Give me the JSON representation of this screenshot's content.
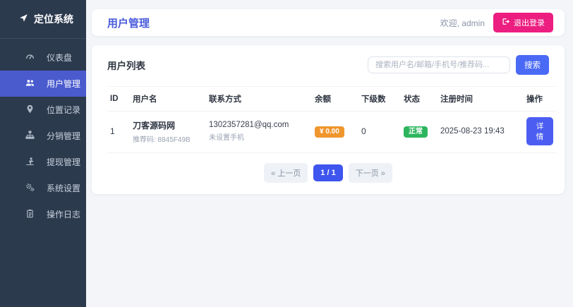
{
  "app": {
    "name": "定位系统",
    "logo_icon": "location-arrow-icon"
  },
  "sidebar": {
    "items": [
      {
        "label": "仪表盘",
        "icon": "gauge-icon",
        "active": false
      },
      {
        "label": "用户管理",
        "icon": "users-icon",
        "active": true
      },
      {
        "label": "位置记录",
        "icon": "map-marker-icon",
        "active": false
      },
      {
        "label": "分销管理",
        "icon": "sitemap-icon",
        "active": false
      },
      {
        "label": "提现管理",
        "icon": "withdraw-icon",
        "active": false
      },
      {
        "label": "系统设置",
        "icon": "gears-icon",
        "active": false
      },
      {
        "label": "操作日志",
        "icon": "log-icon",
        "active": false
      }
    ]
  },
  "header": {
    "title": "用户管理",
    "welcome": "欢迎, admin",
    "logout_label": "退出登录"
  },
  "user_list": {
    "title": "用户列表",
    "search_placeholder": "搜索用户名/邮箱/手机号/推荐码...",
    "search_button": "搜索",
    "table": {
      "headers": [
        "ID",
        "用户名",
        "联系方式",
        "余额",
        "下级数",
        "状态",
        "注册时间",
        "操作"
      ],
      "rows": [
        {
          "id": "1",
          "username": "刀客源码网",
          "ref_code": "推荐码: 8845F49B",
          "email": "1302357281@qq.com",
          "phone_note": "未设置手机",
          "balance": "¥ 0.00",
          "subordinates": "0",
          "status": "正常",
          "registered": "2025-08-23 19:43",
          "action": "详情"
        }
      ]
    },
    "pagination": {
      "prev": "« 上一页",
      "current": "1 / 1",
      "next": "下一页 »"
    }
  },
  "colors": {
    "sidebar_bg": "#2c3a4e",
    "sidebar_active": "#4a5bce",
    "accent_title": "#4a5cdb",
    "logout_pink": "#ec1e80",
    "primary_blue": "#4a6af5",
    "balance_orange": "#f0962e",
    "status_green": "#2db55d",
    "page_bg": "#f3f5f9"
  }
}
